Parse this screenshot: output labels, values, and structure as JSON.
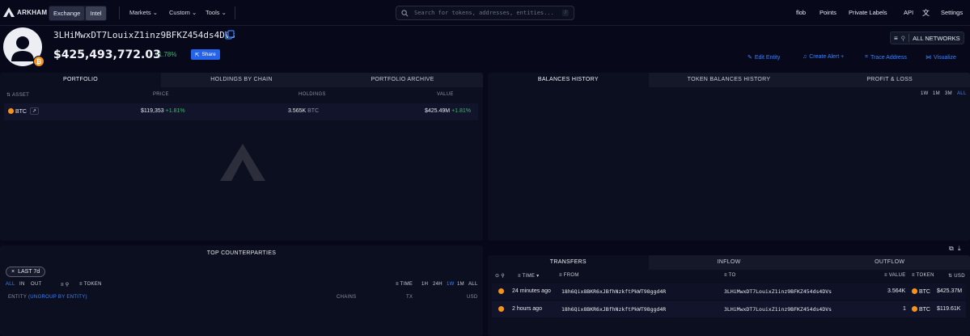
{
  "nav": {
    "logo": "ARKHAM",
    "seg": [
      "Exchange",
      "Intel"
    ],
    "menus": [
      "Markets",
      "Custom",
      "Tools"
    ],
    "search_placeholder": "Search for tokens, addresses, entities...",
    "search_kbd": "/",
    "right": [
      "flob",
      "Points",
      "Private Labels",
      "API",
      "Settings"
    ]
  },
  "header": {
    "address": "3LHiMwxDT7LouixZ1inz9BFKZ454ds4DVs",
    "balance": "$425,493,772.03",
    "change": "+1.78%",
    "share": "Share",
    "networks": "ALL NETWORKS",
    "actions": [
      "Edit Entity",
      "Create Alert +",
      "Trace Address",
      "Visualize"
    ]
  },
  "portfolio": {
    "tabs": [
      "PORTFOLIO",
      "HOLDINGS BY CHAIN",
      "PORTFOLIO ARCHIVE"
    ],
    "columns": [
      "ASSET",
      "PRICE",
      "HOLDINGS",
      "VALUE"
    ],
    "rows": [
      {
        "asset": "BTC",
        "price": "$119,353",
        "price_change": "+1.81%",
        "holdings": "3.565K",
        "holdings_unit": "BTC",
        "value": "$425.49M",
        "value_change": "+1.81%"
      }
    ]
  },
  "balances": {
    "tabs": [
      "BALANCES HISTORY",
      "TOKEN BALANCES HISTORY",
      "PROFIT & LOSS"
    ],
    "ranges": [
      "1W",
      "1M",
      "3M",
      "ALL"
    ]
  },
  "counterparties": {
    "title": "TOP COUNTERPARTIES",
    "chip": "LAST 7d",
    "flow": [
      "ALL",
      "IN",
      "OUT"
    ],
    "token_label": "TOKEN",
    "time_label": "TIME",
    "ranges": [
      "1H",
      "24H",
      "1W",
      "1M",
      "ALL"
    ],
    "columns": [
      "ENTITY",
      "(UNGROUP BY ENTITY)",
      "CHAINS",
      "TX",
      "USD"
    ]
  },
  "transfers": {
    "tabs": [
      "TRANSFERS",
      "INFLOW",
      "OUTFLOW"
    ],
    "columns": [
      "TIME",
      "FROM",
      "TO",
      "VALUE",
      "TOKEN",
      "USD"
    ],
    "rows": [
      {
        "time": "24 minutes ago",
        "from": "18h6Qix8BKR6xJBfhNzkftPkWT98ggd4R",
        "to": "3LHiMwxDT7LouixZ1inz9BFKZ454ds4DVs",
        "value": "3.564K",
        "token": "BTC",
        "usd": "$425.37M"
      },
      {
        "time": "2 hours ago",
        "from": "18h6Qix8BKR6xJBfhNzkftPkWT98ggd4R",
        "to": "3LHiMwxDT7LouixZ1inz9BFKZ454ds4DVs",
        "value": "1",
        "token": "BTC",
        "usd": "$119.61K"
      }
    ]
  }
}
